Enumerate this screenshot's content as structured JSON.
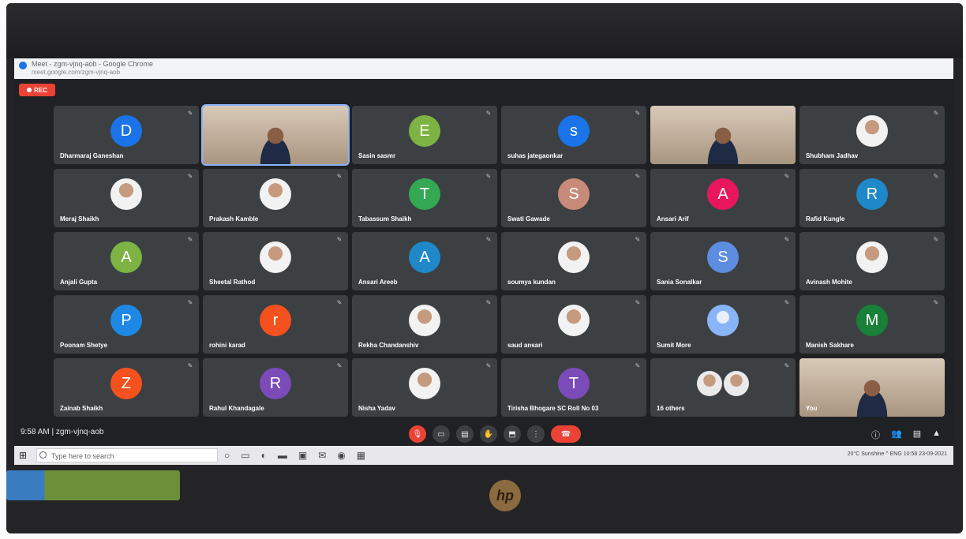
{
  "browser": {
    "title": "Meet - zgm-vjnq-aob - Google Chrome",
    "url": "meet.google.com/zgm-vjnq-aob"
  },
  "meet": {
    "recording_label": "REC",
    "time": "9:58 AM",
    "separator": "|",
    "meeting_code": "zgm-vjnq-aob",
    "accent": "#8ab4f8",
    "leave_color": "#ea4335"
  },
  "tiles": [
    {
      "name": "Dharmaraj Ganeshan",
      "initial": "D",
      "color": "#1a73e8",
      "kind": "letter"
    },
    {
      "name": "",
      "initial": "",
      "color": "",
      "kind": "video-active"
    },
    {
      "name": "Sasin sasmr",
      "initial": "E",
      "color": "#7cb342",
      "kind": "letter"
    },
    {
      "name": "suhas jategaonkar",
      "initial": "s",
      "color": "#1a73e8",
      "kind": "letter"
    },
    {
      "name": "",
      "initial": "",
      "color": "",
      "kind": "video"
    },
    {
      "name": "Shubham Jadhav",
      "initial": "",
      "color": "",
      "kind": "photo"
    },
    {
      "name": "Meraj Shaikh",
      "initial": "",
      "color": "",
      "kind": "photo"
    },
    {
      "name": "Prakash Kamble",
      "initial": "",
      "color": "",
      "kind": "photo"
    },
    {
      "name": "Tabassum Shaikh",
      "initial": "T",
      "color": "#34a853",
      "kind": "letter"
    },
    {
      "name": "Swati Gawade",
      "initial": "S",
      "color": "#c88b7a",
      "kind": "letter"
    },
    {
      "name": "Ansari Arif",
      "initial": "A",
      "color": "#e8175d",
      "kind": "letter"
    },
    {
      "name": "Rafid Kungle",
      "initial": "R",
      "color": "#1e88c8",
      "kind": "letter"
    },
    {
      "name": "Anjali Gupta",
      "initial": "A",
      "color": "#7cb342",
      "kind": "letter"
    },
    {
      "name": "Sheetal Rathod",
      "initial": "",
      "color": "",
      "kind": "photo"
    },
    {
      "name": "Ansari Areeb",
      "initial": "A",
      "color": "#1e88c8",
      "kind": "letter"
    },
    {
      "name": "soumya kundan",
      "initial": "",
      "color": "",
      "kind": "photo"
    },
    {
      "name": "Sania Sonalkar",
      "initial": "S",
      "color": "#5c8de0",
      "kind": "letter"
    },
    {
      "name": "Avinash Mohite",
      "initial": "",
      "color": "",
      "kind": "photo"
    },
    {
      "name": "Poonam Shetye",
      "initial": "P",
      "color": "#1e88e5",
      "kind": "letter"
    },
    {
      "name": "rohini karad",
      "initial": "r",
      "color": "#f4511e",
      "kind": "letter"
    },
    {
      "name": "Rekha Chandanshiv",
      "initial": "",
      "color": "",
      "kind": "photo"
    },
    {
      "name": "saud ansari",
      "initial": "",
      "color": "",
      "kind": "photo"
    },
    {
      "name": "Sumit More",
      "initial": "",
      "color": "",
      "kind": "silhouette"
    },
    {
      "name": "Manish Sakhare",
      "initial": "M",
      "color": "#188038",
      "kind": "letter"
    },
    {
      "name": "Zainab Shaikh",
      "initial": "Z",
      "color": "#f4511e",
      "kind": "letter"
    },
    {
      "name": "Rahul Khandagale",
      "initial": "R",
      "color": "#7b4bb8",
      "kind": "letter"
    },
    {
      "name": "Nisha Yadav",
      "initial": "",
      "color": "",
      "kind": "photo"
    },
    {
      "name": "Tirisha Bhogare SC Roll No 03",
      "initial": "T",
      "color": "#7b4bb8",
      "kind": "letter"
    },
    {
      "name": "16 others",
      "initial": "",
      "color": "",
      "kind": "group"
    },
    {
      "name": "You",
      "initial": "",
      "color": "",
      "kind": "video"
    }
  ],
  "controls": [
    {
      "name": "mic-off-button",
      "icon": "mic-off-icon",
      "glyph": "🎙",
      "red": true
    },
    {
      "name": "camera-button",
      "icon": "camera-icon",
      "glyph": "▭",
      "red": false
    },
    {
      "name": "captions-button",
      "icon": "captions-icon",
      "glyph": "▤",
      "red": false
    },
    {
      "name": "raise-hand-button",
      "icon": "hand-icon",
      "glyph": "✋",
      "red": false
    },
    {
      "name": "present-button",
      "icon": "present-icon",
      "glyph": "⬒",
      "red": false
    },
    {
      "name": "more-options-button",
      "icon": "more-vert-icon",
      "glyph": "⋮",
      "red": false
    },
    {
      "name": "leave-call-button",
      "icon": "phone-hangup-icon",
      "glyph": "☎",
      "red": true,
      "pill": true
    }
  ],
  "right_controls": [
    {
      "name": "meeting-details-button",
      "icon": "info-icon",
      "glyph": "ⓘ"
    },
    {
      "name": "people-button",
      "icon": "people-icon",
      "glyph": "👥"
    },
    {
      "name": "chat-button",
      "icon": "chat-icon",
      "glyph": "▤"
    },
    {
      "name": "activities-button",
      "icon": "activities-icon",
      "glyph": "▲"
    }
  ],
  "taskbar": {
    "search_placeholder": "Type here to search",
    "tray_text": "20°C Sunshine  ^  ENG  10:58  23-09-2021"
  },
  "hardware": {
    "brand": "hp"
  }
}
